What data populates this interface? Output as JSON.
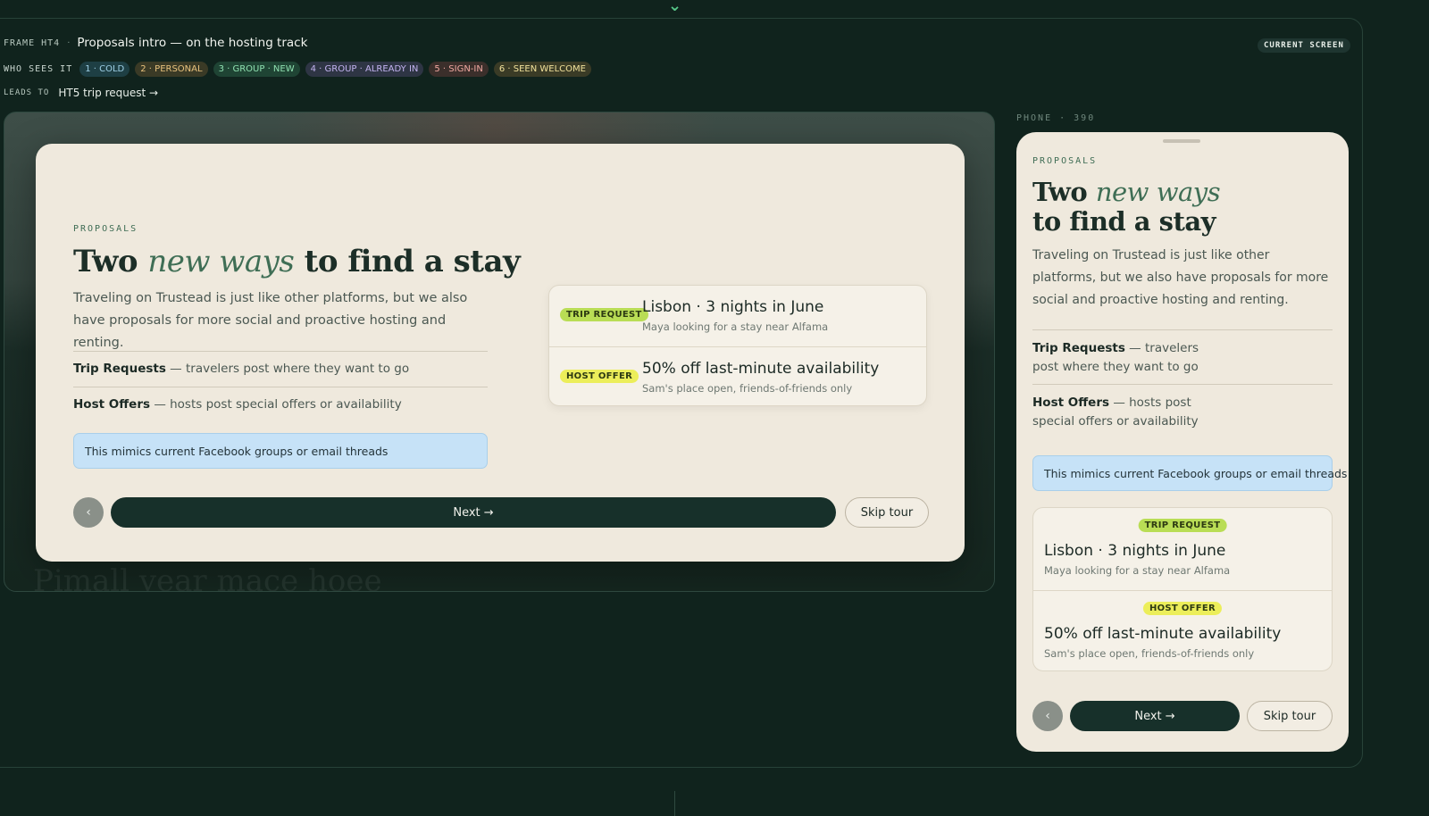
{
  "frame": {
    "id": "FRAME HT4",
    "separator": "·",
    "title": "Proposals intro — on the hosting track",
    "current_screen_badge": "CURRENT SCREEN"
  },
  "audience": {
    "label": "WHO SEES IT",
    "chips": [
      {
        "text": "1 · COLD",
        "color": "#9fd0e6",
        "bg": "#1e3f44"
      },
      {
        "text": "2 · PERSONAL",
        "color": "#e8c27d",
        "bg": "#3a3a26"
      },
      {
        "text": "3 · GROUP · NEW",
        "color": "#8fe0b0",
        "bg": "#1f4434"
      },
      {
        "text": "4 · GROUP · ALREADY IN",
        "color": "#c3b3f0",
        "bg": "#2e3544"
      },
      {
        "text": "5 · SIGN-IN",
        "color": "#f0a8a0",
        "bg": "#3b2f2b"
      },
      {
        "text": "6 · SEEN WELCOME",
        "color": "#f0e09a",
        "bg": "#3a3b26"
      }
    ]
  },
  "leads_to": {
    "label": "LEADS TO",
    "target": "HT5 trip request →"
  },
  "desktop": {
    "eyebrow": "PROPOSALS",
    "headline_pre": "Two ",
    "headline_accent": "new ways",
    "headline_post": " to find a stay",
    "lede": "Traveling on Trustead is just like other platforms, but we also have proposals for more social and proactive hosting and renting.",
    "features": [
      {
        "title": "Trip Requests",
        "desc": " — travelers post where they want to go"
      },
      {
        "title": "Host Offers",
        "desc": " — hosts post special offers or availability"
      }
    ],
    "note": "This mimics current Facebook groups or email threads",
    "cards": [
      {
        "tag": "TRIP REQUEST",
        "title": "Lisbon · 3 nights in June",
        "sub": "Maya looking for a stay near Alfama"
      },
      {
        "tag": "HOST OFFER",
        "title": "50% off last-minute availability",
        "sub": "Sam's place open, friends-of-friends only"
      }
    ],
    "back_glyph": "‹",
    "next_label": "Next →",
    "skip_label": "Skip tour",
    "ghost": "Pimall year mace hoee"
  },
  "phone": {
    "label": "PHONE · 390",
    "eyebrow": "PROPOSALS",
    "headline_pre": "Two ",
    "headline_accent": "new ways",
    "headline_post": "to find a stay",
    "lede": "Traveling on Trustead is just like other platforms, but we also have proposals for more social and proactive hosting and renting.",
    "features": [
      {
        "title": "Trip Requests",
        "desc_line1": " — travelers",
        "desc_line2": "post where they want to go"
      },
      {
        "title": "Host Offers",
        "desc_line1": " — hosts post",
        "desc_line2": "special offers or availability"
      }
    ],
    "note": "This mimics current Facebook groups or email threads",
    "cards": [
      {
        "tag": "TRIP REQUEST",
        "title": "Lisbon · 3 nights in June",
        "sub": "Maya looking for a stay near Alfama"
      },
      {
        "tag": "HOST OFFER",
        "title": "50% off last-minute availability",
        "sub": "Sam's place open, friends-of-friends only"
      }
    ],
    "back_glyph": "‹",
    "next_label": "Next →",
    "skip_label": "Skip tour"
  },
  "icons": {
    "top_arrow": "chevron-down-icon",
    "back": "chevron-left-icon"
  }
}
